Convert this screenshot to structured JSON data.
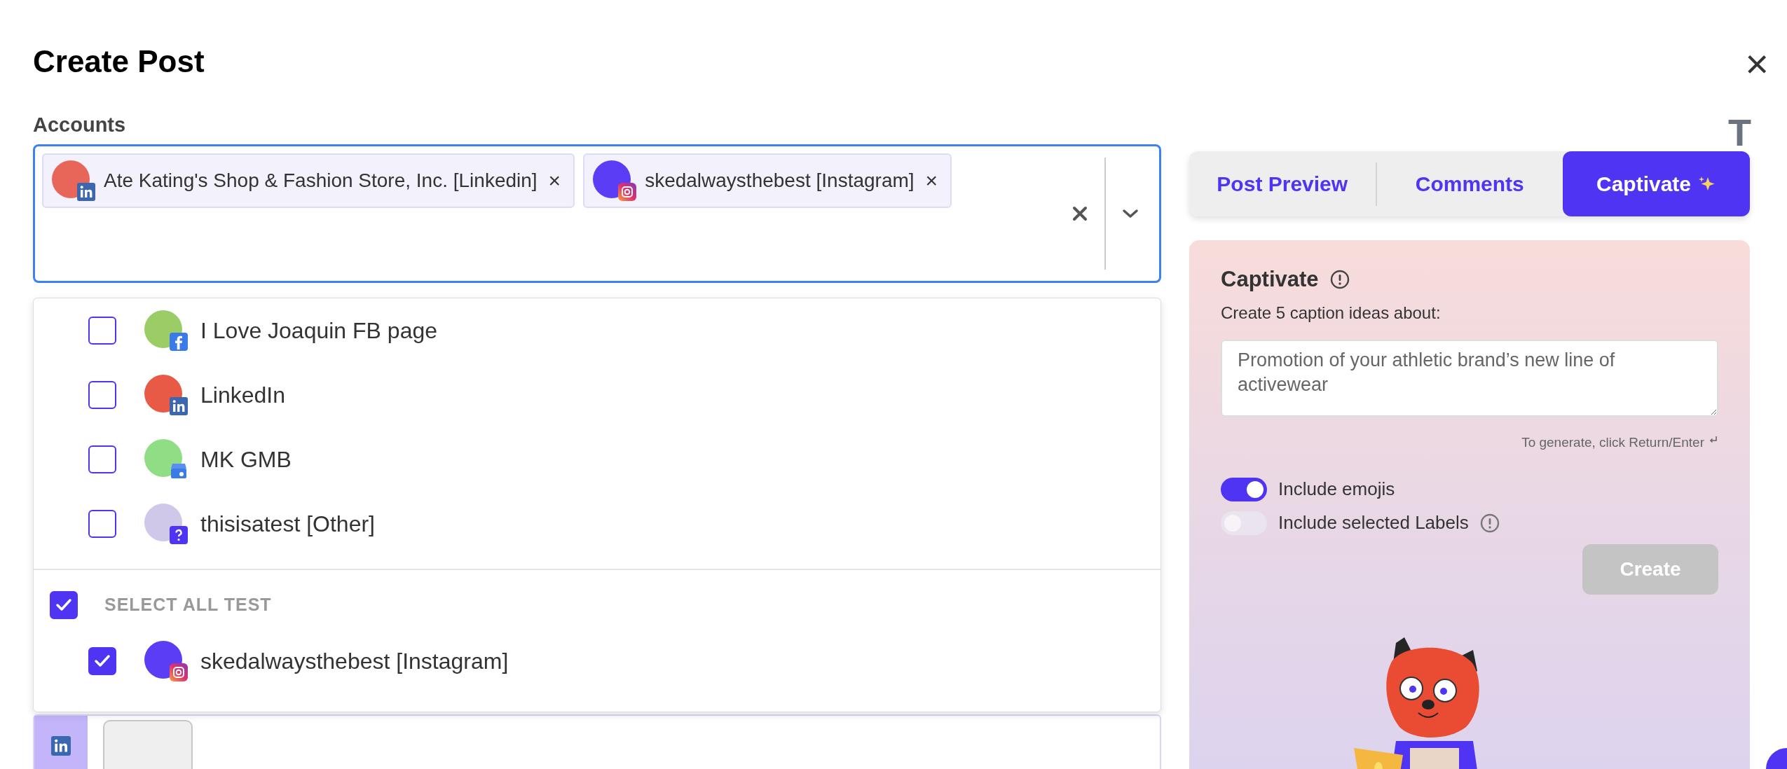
{
  "title": "Create Post",
  "close_glyph": "×",
  "format_glyph": "T",
  "accounts": {
    "label": "Accounts",
    "chips": [
      {
        "name": "Ate Kating's Shop & Fashion Store, Inc. [Linkedin]",
        "kind": "linkedin",
        "color": "#e8655a",
        "remove": "×"
      },
      {
        "name": "skedalwaysthebest [Instagram]",
        "kind": "instagram",
        "color": "#5b3df5",
        "remove": "×"
      }
    ]
  },
  "dropdown": {
    "items": [
      {
        "name": "I Love Joaquin FB page",
        "kind": "facebook",
        "color": "#9ccc65",
        "checked": false
      },
      {
        "name": "LinkedIn",
        "kind": "linkedin",
        "color": "#e85a45",
        "checked": false
      },
      {
        "name": "MK GMB",
        "kind": "gmb",
        "color": "#8fdd84",
        "checked": false
      },
      {
        "name": "thisisatest [Other]",
        "kind": "other",
        "color": "#cfc8e8",
        "checked": false
      }
    ],
    "group": {
      "label": "SELECT ALL TEST",
      "checked": true,
      "items": [
        {
          "name": "skedalwaysthebest [Instagram]",
          "kind": "instagram",
          "color": "#5b3df5",
          "checked": true
        }
      ]
    }
  },
  "tabs": [
    {
      "label": "Post Preview",
      "selected": false,
      "sparkle": false
    },
    {
      "label": "Comments",
      "selected": false,
      "sparkle": false
    },
    {
      "label": "Captivate",
      "selected": true,
      "sparkle": true
    }
  ],
  "captivate": {
    "title": "Captivate",
    "prompt_label": "Create 5 caption ideas about:",
    "placeholder": "Promotion of your athletic brand’s new line of activewear",
    "hint": "To generate, click Return/Enter",
    "toggles": [
      {
        "label": "Include emojis",
        "on": true,
        "info": false
      },
      {
        "label": "Include selected Labels",
        "on": false,
        "info": true
      }
    ],
    "create_button": {
      "label": "Create",
      "disabled": true
    }
  },
  "editor": {
    "kind": "linkedin"
  }
}
